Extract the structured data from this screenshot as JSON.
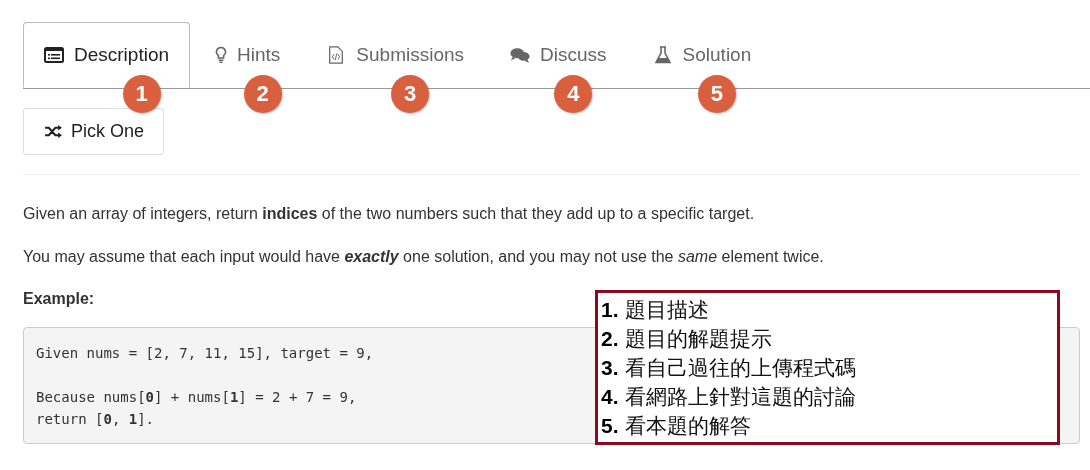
{
  "tabs": [
    {
      "label": "Description",
      "kind": "description",
      "selected": true,
      "badge": "1"
    },
    {
      "label": "Hints",
      "kind": "hints",
      "selected": false,
      "badge": "2"
    },
    {
      "label": "Submissions",
      "kind": "submissions",
      "selected": false,
      "badge": "3"
    },
    {
      "label": "Discuss",
      "kind": "discuss",
      "selected": false,
      "badge": "4"
    },
    {
      "label": "Solution",
      "kind": "solution",
      "selected": false,
      "badge": "5"
    }
  ],
  "pick_button": {
    "label": "Pick One"
  },
  "paragraphs": [
    "Given an array of integers, return **indices** of the two numbers such that they add up to a specific target.",
    "You may assume that each input would have **exactly** one solution, and you may not use the *same* element twice."
  ],
  "example_heading": "Example:",
  "code_lines": [
    {
      "text": "Given nums = [2, 7, 11, 15], target = 9,",
      "blank_before": false
    },
    {
      "text": "Because nums[**0**] + nums[**1**] = 2 + 7 = 9,",
      "blank_before": true
    },
    {
      "text": "return [**0**, **1**].",
      "blank_before": false
    }
  ],
  "annotation": [
    {
      "number": "1.",
      "text": "題目描述"
    },
    {
      "number": "2.",
      "text": "題目的解題提示"
    },
    {
      "number": "3.",
      "text": "看自己過往的上傳程式碼"
    },
    {
      "number": "4.",
      "text": "看網路上針對這題的討論"
    },
    {
      "number": "5.",
      "text": "看本題的解答"
    }
  ]
}
